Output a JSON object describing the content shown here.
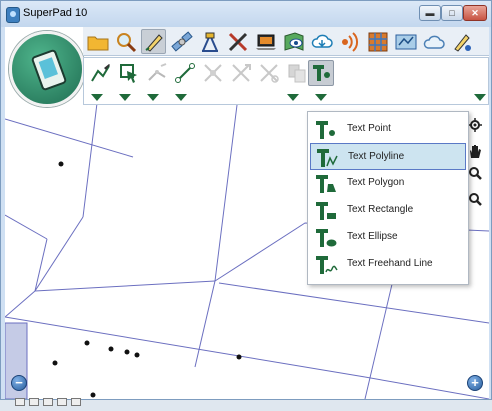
{
  "window": {
    "title": "SuperPad 10",
    "controls": {
      "minimize_glyph": "▬",
      "maximize_glyph": "□",
      "close_glyph": "✕"
    }
  },
  "colors": {
    "titlebar": "#c3d7ee",
    "map_line": "#6b6fc0",
    "icon_green": "#1f6a3a",
    "menu_highlight": "#cde4f0",
    "menu_highlight_border": "#5a79c6"
  },
  "toolbar_top": {
    "tools": [
      {
        "name": "open-folder-icon"
      },
      {
        "name": "search-icon"
      },
      {
        "name": "edit-pencil-icon",
        "active": true
      },
      {
        "name": "satellite-icon"
      },
      {
        "name": "survey-instrument-icon"
      },
      {
        "name": "tools-icon"
      },
      {
        "name": "laptop-icon"
      },
      {
        "name": "map-layer-eye-icon"
      },
      {
        "name": "cloud-sync-icon"
      },
      {
        "name": "gps-signal-icon"
      },
      {
        "name": "grid-icon"
      },
      {
        "name": "map-view-icon"
      },
      {
        "name": "cloud-icon"
      },
      {
        "name": "settings-pencil-icon"
      }
    ]
  },
  "toolbar_edit": {
    "tools": [
      {
        "name": "draw-line-icon",
        "enabled": true
      },
      {
        "name": "select-feature-icon",
        "enabled": true
      },
      {
        "name": "edit-vertices-icon",
        "enabled": false
      },
      {
        "name": "connect-points-icon",
        "enabled": true
      },
      {
        "name": "move-feature-icon",
        "enabled": false
      },
      {
        "name": "split-feature-icon",
        "enabled": false
      },
      {
        "name": "rotate-feature-icon",
        "enabled": false
      },
      {
        "name": "copy-feature-icon",
        "enabled": false
      },
      {
        "name": "text-tool-icon",
        "enabled": true,
        "selected": true
      }
    ]
  },
  "text_menu": {
    "items": [
      {
        "label": "Text Point",
        "icon": "text-point-icon"
      },
      {
        "label": "Text Polyline",
        "icon": "text-polyline-icon",
        "highlighted": true
      },
      {
        "label": "Text Polygon",
        "icon": "text-polygon-icon"
      },
      {
        "label": "Text Rectangle",
        "icon": "text-rectangle-icon"
      },
      {
        "label": "Text Ellipse",
        "icon": "text-ellipse-icon"
      },
      {
        "label": "Text Freehand Line",
        "icon": "text-freehand-icon"
      }
    ]
  },
  "map_controls": {
    "zoom_in_glyph": "+",
    "zoom_out_glyph": "−",
    "side_tools": [
      "locate-icon",
      "pan-hand-icon",
      "zoom-in-magnifier-icon",
      "zoom-out-magnifier-icon"
    ]
  }
}
